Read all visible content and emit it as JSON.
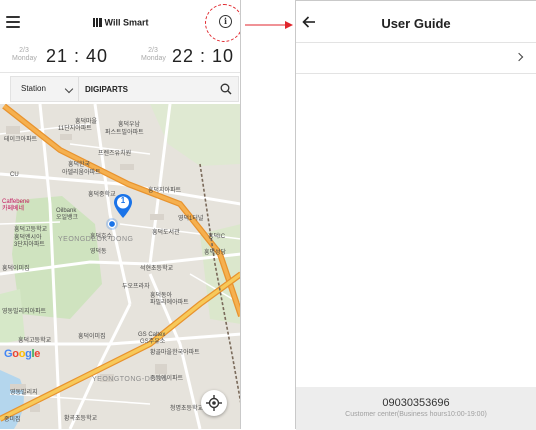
{
  "header": {
    "brand": "Will Smart"
  },
  "times": [
    {
      "date_line1": "2/3",
      "date_line2": "Monday",
      "time": "21 : 40"
    },
    {
      "date_line1": "2/3",
      "date_line2": "Monday",
      "time": "22 : 10"
    }
  ],
  "search": {
    "station_select": "Station",
    "query_value": "DIGIPARTS"
  },
  "map": {
    "marker_count": "1",
    "google": "Google",
    "labels": [
      "흥덕마을",
      "흥덕우남",
      "11단지아파트",
      "퍼스트빌아파트",
      "테이크아파트",
      "프렌즈유치원",
      "흥덕한국",
      "아델리움아파트",
      "CU",
      "흥덕지아파트",
      "Caffebene",
      "카페베네",
      "Oilbank",
      "오일뱅크",
      "흥덕중학교",
      "영덕1터널",
      "흥덕도서관",
      "흥덕IC",
      "흥덕성당",
      "흥덕고등학교",
      "흥덕호수",
      "영덕동",
      "흥덕엔시아",
      "3단지아파트",
      "흥덕이미집",
      "석현초등학교",
      "두오프라자",
      "흥덕동아",
      "파밀리에아파트",
      "영동빌리지아파트",
      "흥덕고등학교",
      "GS Caltex",
      "GS주유소",
      "황골마을한국아파트",
      "흥덕이미집",
      "중앙에이파트",
      "영동빌리지",
      "청명초등학교",
      "황곡초등학교",
      "중미집"
    ],
    "districts": [
      "YEONGDEOK-DONG",
      "YEONGTONG-DONG"
    ]
  },
  "guide": {
    "title": "User Guide",
    "footer_phone": "09030353696",
    "footer_hours": "Customer center(Business hours10:00-19:00)"
  },
  "colors": {
    "highway": "#f2a33a",
    "annotation": "#e0262c",
    "marker": "#1a73e8"
  }
}
